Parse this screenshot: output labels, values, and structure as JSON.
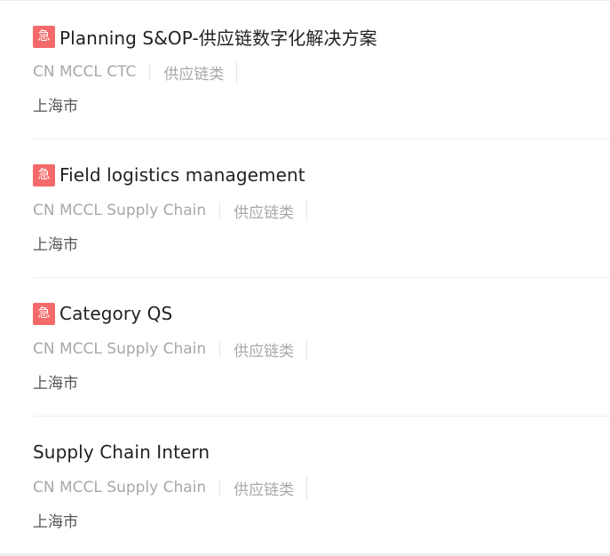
{
  "jobs": [
    {
      "urgent_label": "急",
      "title": "Planning S&OP-供应链数字化解决方案",
      "department": "CN MCCL CTC",
      "category": "供应链类",
      "location": "上海市"
    },
    {
      "urgent_label": "急",
      "title": "Field logistics management",
      "department": "CN MCCL Supply Chain",
      "category": "供应链类",
      "location": "上海市"
    },
    {
      "urgent_label": "急",
      "title": "Category QS",
      "department": "CN MCCL Supply Chain",
      "category": "供应链类",
      "location": "上海市"
    },
    {
      "title": "Supply Chain Intern",
      "department": "CN MCCL Supply Chain",
      "category": "供应链类",
      "location": "上海市"
    }
  ],
  "colors": {
    "urgent_badge": "#f46a6a",
    "title": "#222222",
    "meta": "#a8a8a8",
    "location": "#555555"
  }
}
